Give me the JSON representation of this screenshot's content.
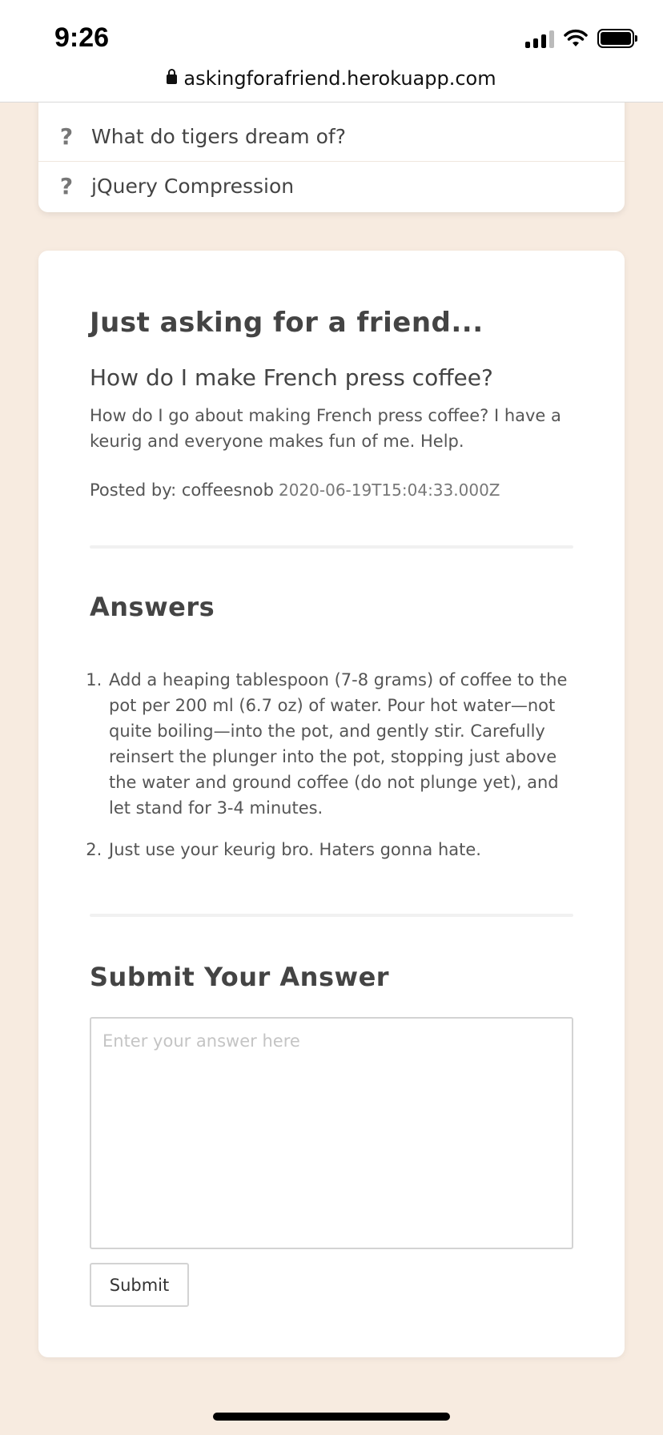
{
  "status_bar": {
    "time": "9:26",
    "url": "askingforafriend.herokuapp.com"
  },
  "question_list": {
    "items": [
      {
        "icon": "?",
        "label": "What do tigers dream of?"
      },
      {
        "icon": "?",
        "label": "jQuery Compression"
      }
    ]
  },
  "question": {
    "heading": "Just asking for a friend...",
    "title": "How do I make French press coffee?",
    "body": "How do I go about making French press coffee? I have a keurig and everyone makes fun of me. Help.",
    "posted_by_label": "Posted by: coffeesnob",
    "timestamp": "2020-06-19T15:04:33.000Z"
  },
  "answers": {
    "heading": "Answers",
    "items": [
      "Add a heaping tablespoon (7-8 grams) of coffee to the pot per 200 ml (6.7 oz) of water. Pour hot water—not quite boiling—into the pot, and gently stir. Carefully reinsert the plunger into the pot, stopping just above the water and ground coffee (do not plunge yet), and let stand for 3-4 minutes.",
      "Just use your keurig bro. Haters gonna hate."
    ]
  },
  "submit": {
    "heading": "Submit Your Answer",
    "placeholder": "Enter your answer here",
    "value": "",
    "button_label": "Submit"
  }
}
